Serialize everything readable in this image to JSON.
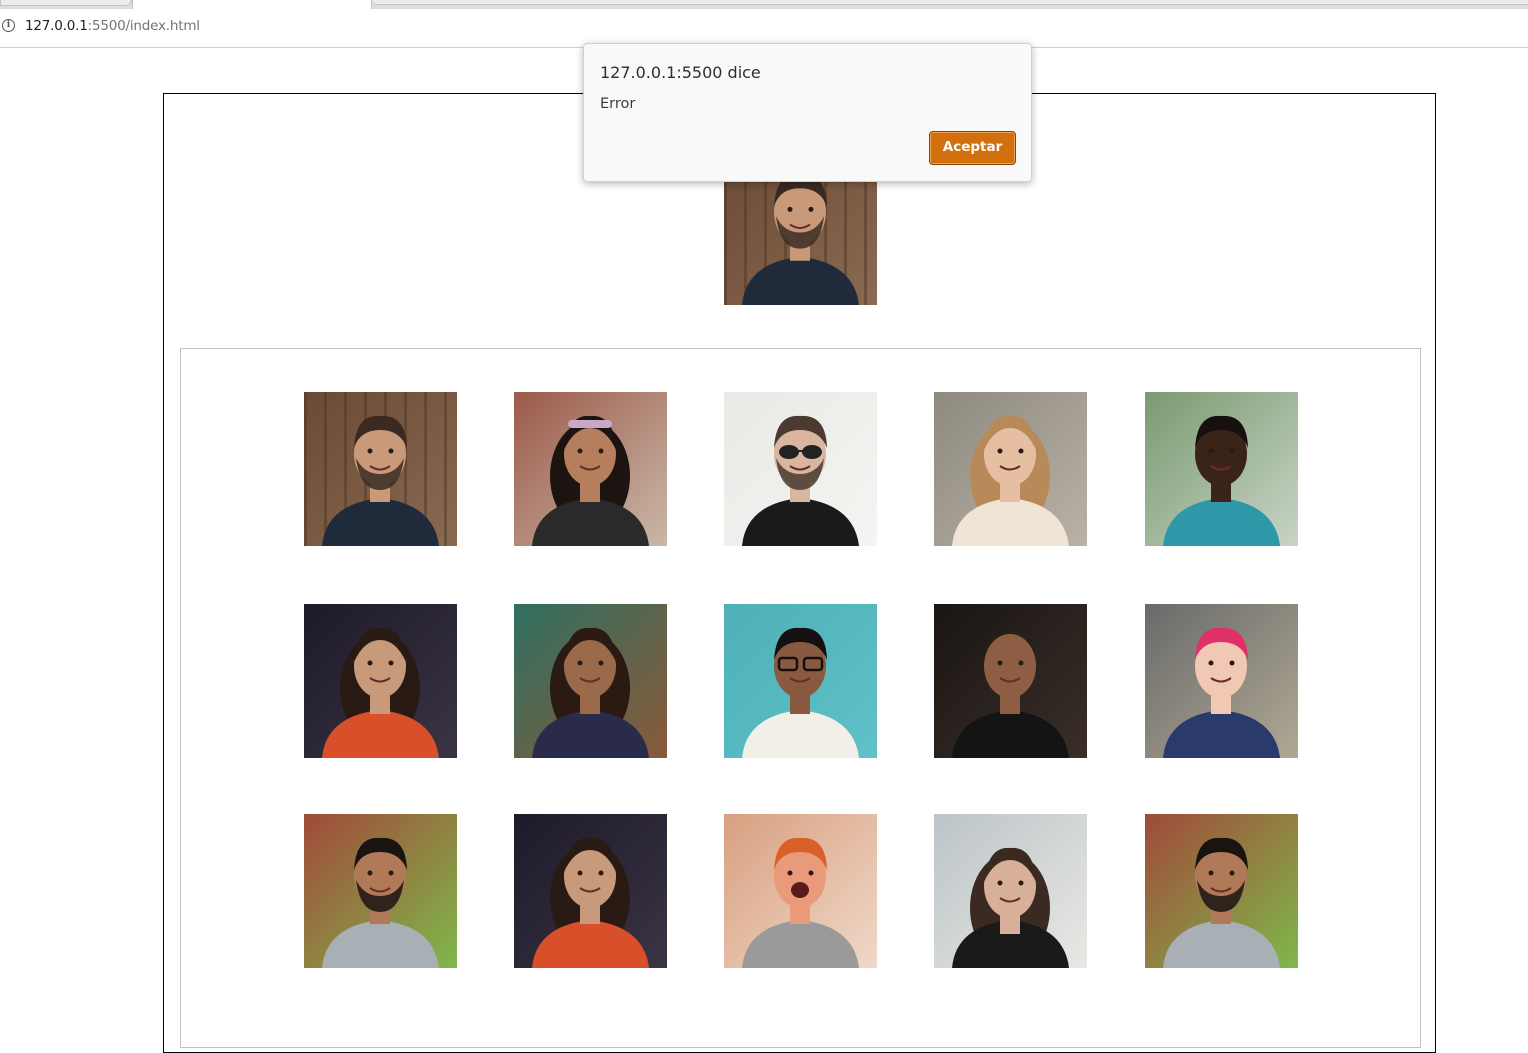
{
  "browser": {
    "url_host": "127.0.0.1",
    "url_rest": ":5500/index.html",
    "info_icon": "info-icon"
  },
  "dialog": {
    "title": "127.0.0.1:5500 dice",
    "message": "Error",
    "ok_label": "Aceptar",
    "accent_color": "#d3700e"
  },
  "selected_photo": {
    "person": "man-bearded-denim-shirt"
  },
  "gallery": {
    "rows": [
      [
        "man-bearded-denim-shirt",
        "woman-sunglasses-on-head",
        "man-aviator-sunglasses-pipe",
        "woman-blonde-street",
        "man-teal-shirt-park"
      ],
      [
        "woman-orange-top-necklace",
        "man-long-locs",
        "woman-glasses-teal-wall",
        "man-bald-dark-background",
        "woman-pink-hair-bookshelf"
      ],
      [
        "man-gray-sweater-buildings",
        "woman-orange-top-necklace",
        "man-excited-thumbs-up",
        "woman-long-dark-hair",
        "man-gray-sweater-buildings"
      ]
    ]
  }
}
